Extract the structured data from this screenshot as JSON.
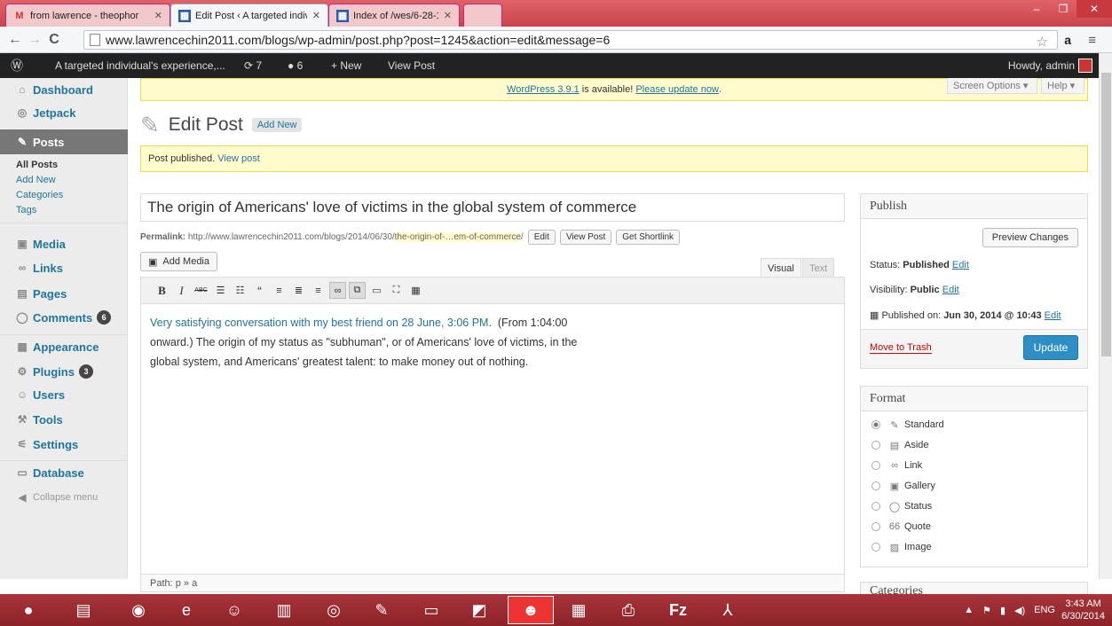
{
  "browser": {
    "tabs": [
      {
        "icon": "gmail-icon",
        "title": "from lawrence - theophor"
      },
      {
        "icon": "page-icon",
        "title": "Edit Post ‹ A targeted indiv"
      },
      {
        "icon": "page-icon",
        "title": "Index of /wes/6-28-14"
      }
    ],
    "url": "www.lawrencechin2011.com/blogs/wp-admin/post.php?post=1245&action=edit&message=6"
  },
  "adminbar": {
    "site": "A targeted individual's experience,...",
    "updates": "7",
    "comments": "6",
    "new_label": "+ New",
    "view_post": "View Post",
    "howdy": "Howdy, admin"
  },
  "sidebar": {
    "dashboard": "Dashboard",
    "jetpack": "Jetpack",
    "posts": "Posts",
    "sub": [
      "All Posts",
      "Add New",
      "Categories",
      "Tags"
    ],
    "media": "Media",
    "links": "Links",
    "pages": "Pages",
    "comments": "Comments",
    "comments_badge": "6",
    "appearance": "Appearance",
    "plugins": "Plugins",
    "plugins_badge": "3",
    "users": "Users",
    "tools": "Tools",
    "settings": "Settings",
    "database": "Database",
    "collapse": "Collapse menu"
  },
  "update_nag": {
    "link": "WordPress 3.9.1",
    "mid": " is available! ",
    "link2": "Please update now",
    "end": "."
  },
  "screen_options": "Screen Options ▾",
  "help": "Help ▾",
  "page_title": "Edit Post",
  "add_new": "Add New",
  "notice": {
    "text": "Post published. ",
    "link": "View post"
  },
  "post_title": "The origin of Americans' love of victims in the global system of commerce",
  "permalink": {
    "label": "Permalink:",
    "base": "http://www.lawrencechin2011.com/blogs/2014/06/30/",
    "slug": "the-origin-of-…em-of-commerce",
    "slash": "/",
    "edit": "Edit",
    "view": "View Post",
    "shortlink": "Get Shortlink"
  },
  "add_media": "Add Media",
  "editor_tabs": {
    "visual": "Visual",
    "text": "Text"
  },
  "content": {
    "link": "Very satisfying conversation with my best friend on 28 June, 3:06 PM",
    "rest1": ".  (From 1:04:00",
    "line2": "onward.) The origin of my status as \"subhuman\", or of Americans' love of victims, in the",
    "line3": "global system, and Americans' greatest talent: to make money out of nothing."
  },
  "path": "Path: p » a",
  "publish": {
    "title": "Publish",
    "preview": "Preview Changes",
    "status_label": "Status: ",
    "status": "Published",
    "visibility_label": "Visibility: ",
    "visibility": "Public",
    "published_label": "Published on: ",
    "published": "Jun 30, 2014 @ 10:43",
    "edit": "Edit",
    "trash": "Move to Trash",
    "update": "Update"
  },
  "format": {
    "title": "Format",
    "options": [
      "Standard",
      "Aside",
      "Link",
      "Gallery",
      "Status",
      "Quote",
      "Image"
    ],
    "selected": "Standard"
  },
  "categories_title": "Categories",
  "tray": {
    "lang": "ENG",
    "time": "3:43 AM",
    "date": "6/30/2014"
  }
}
